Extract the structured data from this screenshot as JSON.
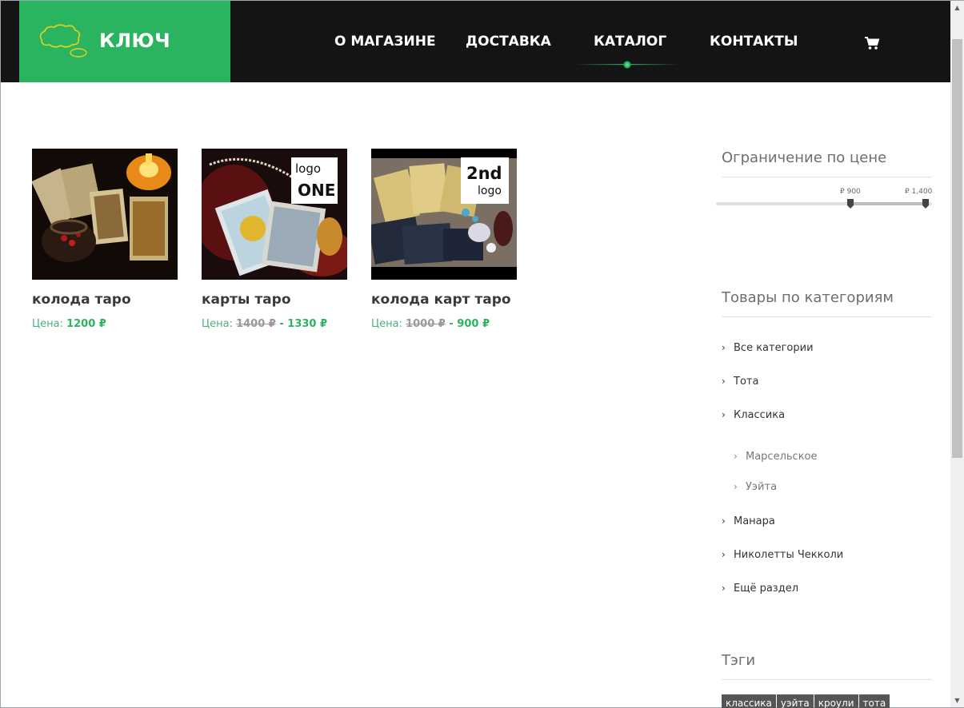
{
  "header": {
    "brand_name": "КЛЮЧ",
    "nav": [
      {
        "label": "О МАГАЗИНЕ"
      },
      {
        "label": "ДОСТАВКА"
      },
      {
        "label": "КАТАЛОГ",
        "active": true
      },
      {
        "label": "КОНТАКТЫ"
      }
    ],
    "cart_icon": "shopping-cart-icon"
  },
  "products": [
    {
      "title": "колода таро",
      "price_label": "Цена:",
      "price": "1200 ₽"
    },
    {
      "title": "карты таро",
      "price_label": "Цена:",
      "price_old": "1400 ₽",
      "separator": " - ",
      "price_new": "1330 ₽",
      "badge_line1": "logo",
      "badge_line2": "ONE"
    },
    {
      "title": "колода карт таро",
      "price_label": "Цена:",
      "price_old": "1000 ₽",
      "separator": " - ",
      "price_new": "900 ₽",
      "badge_line1": "2nd",
      "badge_line2": "logo"
    }
  ],
  "sidebar": {
    "price_filter": {
      "title": "Ограничение по цене",
      "min_label": "₽ 900",
      "max_label": "₽ 1,400"
    },
    "categories": {
      "title": "Товары по категориям",
      "items": [
        {
          "label": "Все категории"
        },
        {
          "label": "Тота"
        },
        {
          "label": "Классика"
        },
        {
          "label": "Марсельское",
          "sub": true
        },
        {
          "label": "Уэйта",
          "sub": true
        },
        {
          "label": "Манара"
        },
        {
          "label": "Николетты Чекколи"
        },
        {
          "label": "Ещё раздел"
        }
      ]
    },
    "tags": {
      "title": "Тэги",
      "items": [
        "классика",
        "уэйта",
        "кроули",
        "тота"
      ]
    }
  },
  "colors": {
    "brand_green": "#2bb45f",
    "header_bg": "#141414",
    "tag_bg": "#555555"
  }
}
